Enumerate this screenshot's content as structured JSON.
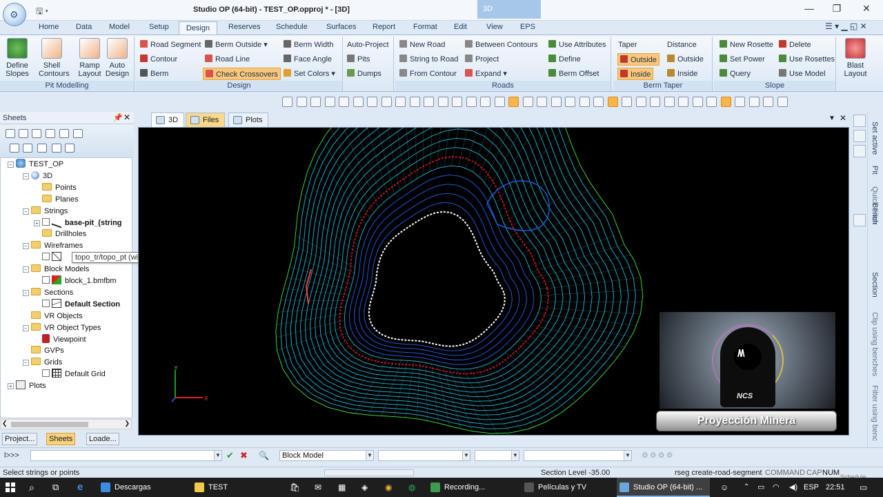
{
  "window": {
    "title": "Studio OP (64-bit) - TEST_OP.opproj * - [3D]",
    "context_tab": "3D"
  },
  "ribbon_tabs": [
    "Home",
    "Data",
    "Model",
    "Setup",
    "Design",
    "Reserves",
    "Schedule",
    "Surfaces",
    "Report",
    "Format",
    "Edit",
    "View",
    "EPS"
  ],
  "ribbon": {
    "pit": {
      "label": "Pit Modelling",
      "buttons": [
        [
          "Define",
          "Slopes"
        ],
        [
          "Shell",
          "Contours"
        ],
        [
          "Ramp",
          "Layout"
        ],
        [
          "Auto",
          "Design"
        ]
      ]
    },
    "design": {
      "label": "Design",
      "road_segment": "Road Segment",
      "contour": "Contour",
      "berm": "Berm",
      "berm_outside": "Berm Outside",
      "road_line": "Road Line",
      "check_crossovers": "Check Crossovers",
      "berm_width": "Berm Width",
      "face_angle": "Face Angle",
      "set_colors": "Set Colors"
    },
    "auto": {
      "auto_project": "Auto-Project",
      "pits": "Pits",
      "dumps": "Dumps"
    },
    "roads": {
      "label": "Roads",
      "new_road": "New Road",
      "string_to_road": "String to Road",
      "from_contour": "From Contour",
      "between_contours": "Between Contours",
      "project": "Project",
      "expand": "Expand"
    },
    "attr": {
      "use_attributes": "Use Attributes",
      "define": "Define",
      "berm_offset": "Berm Offset"
    },
    "berm_taper": {
      "label": "Berm Taper",
      "taper": "Taper",
      "outside": "Outside",
      "inside": "Inside",
      "distance": "Distance",
      "dist_outside": "Outside",
      "dist_inside": "Inside"
    },
    "slope": {
      "label": "Slope",
      "new_rosette": "New Rosette",
      "set_power": "Set Power",
      "query": "Query",
      "delete": "Delete",
      "use_rosettes": "Use Rosettes",
      "use_model": "Use Model"
    },
    "blast": {
      "line1": "Blast",
      "line2": "Layout"
    }
  },
  "sheets": {
    "title": "Sheets",
    "tree": {
      "root": "TEST_OP",
      "view3d": "3D",
      "points": "Points",
      "planes": "Planes",
      "strings": "Strings",
      "base_pit": "base-pit_(string",
      "drillholes": "Drillholes",
      "wireframes": "Wireframes",
      "block_models": "Block Models",
      "block_file": "block_1.bmfbm",
      "sections": "Sections",
      "default_section": "Default Section",
      "vr_objects": "VR Objects",
      "vr_object_types": "VR Object Types",
      "viewpoint": "Viewpoint",
      "gvps": "GVPs",
      "grids": "Grids",
      "default_grid": "Default Grid",
      "plots": "Plots"
    },
    "tooltip": "topo_tr/topo_pt (wireframe)",
    "panel_tabs": [
      "Project...",
      "Sheets",
      "Loade..."
    ]
  },
  "doc_tabs": [
    "3D",
    "Files",
    "Plots"
  ],
  "right_panel": [
    "Set active",
    "Pit",
    "Quick Filter",
    "Bench",
    "Section",
    "Clip using benches",
    "Filter using benc"
  ],
  "overlay": {
    "banner": "Proyección Minera",
    "logo_text": "NCS"
  },
  "axes": {
    "x": "X",
    "y": "Y"
  },
  "command_bar": {
    "prompt": "l>>>",
    "block_model": "Block Model"
  },
  "status": {
    "left": "Select strings or points",
    "section_level": "Section Level -35.00",
    "command_hint": "rseg create-road-segment",
    "command": "COMMAND",
    "cap": "CAP",
    "num": "NUM",
    "overflow": "Schedule"
  },
  "taskbar": {
    "items": [
      "Descargas",
      "TEST",
      "Recording...",
      "Películas y TV",
      "Studio OP (64-bit) ..."
    ],
    "language": "ESP",
    "time": "22:51"
  }
}
